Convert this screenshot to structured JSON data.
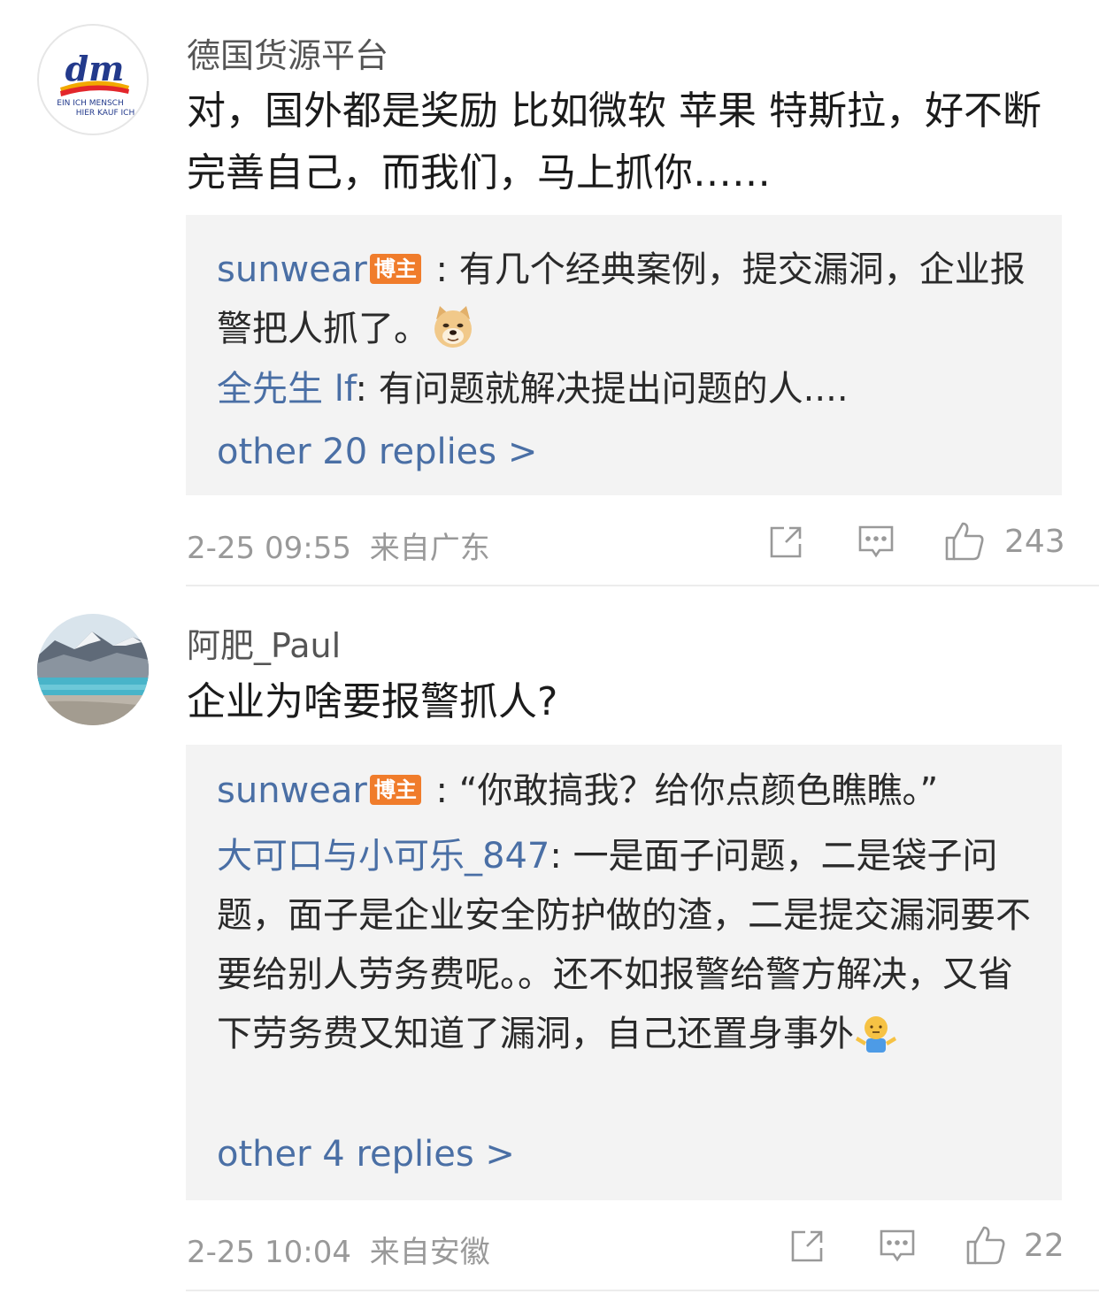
{
  "comments": [
    {
      "avatar_icon": "dm-logo-icon",
      "logo_text": {
        "brand": "dm",
        "line1": "EIN ICH MENSCH",
        "line2": "HIER KAUF ICH"
      },
      "username": "德国货源平台",
      "text": "对，国外都是奖励 比如微软 苹果 特斯拉，好不断完善自己，而我们，马上抓你……",
      "replies": [
        {
          "name": "sunwear",
          "badge": "博主",
          "sep": " : ",
          "text": "有几个经典案例，提交漏洞，企业报警把人抓了。",
          "emoji": "doge-emoji-icon"
        },
        {
          "name": "全先生 lf",
          "sep": ": ",
          "text": "有问题就解决提出问题的人...."
        }
      ],
      "more_replies": "other 20 replies >",
      "time": "2-25 09:55",
      "location": "来自广东",
      "likes": "243"
    },
    {
      "avatar_icon": "landscape-avatar-icon",
      "username": "阿肥_Paul",
      "text": "企业为啥要报警抓人?",
      "replies": [
        {
          "name": "sunwear",
          "badge": "博主",
          "sep": " : ",
          "text": "“你敢搞我？给你点颜色瞧瞧。”"
        },
        {
          "name": "大可口与小可乐_847",
          "sep": ": ",
          "text": "一是面子问题，二是袋子问题，面子是企业安全防护做的渣，二是提交漏洞要不要给别人劳务费呢。。还不如报警给警方解决，又省下劳务费又知道了漏洞，自己还置身事外",
          "emoji": "shrug-emoji-icon"
        }
      ],
      "more_replies": "other 4 replies >",
      "time": "2-25 10:04",
      "location": "来自安徽",
      "likes": "22"
    }
  ],
  "colors": {
    "link": "#4a6fa5",
    "badge": "#f07c2b",
    "meta": "#999999",
    "reply_bg": "#f3f3f3"
  }
}
